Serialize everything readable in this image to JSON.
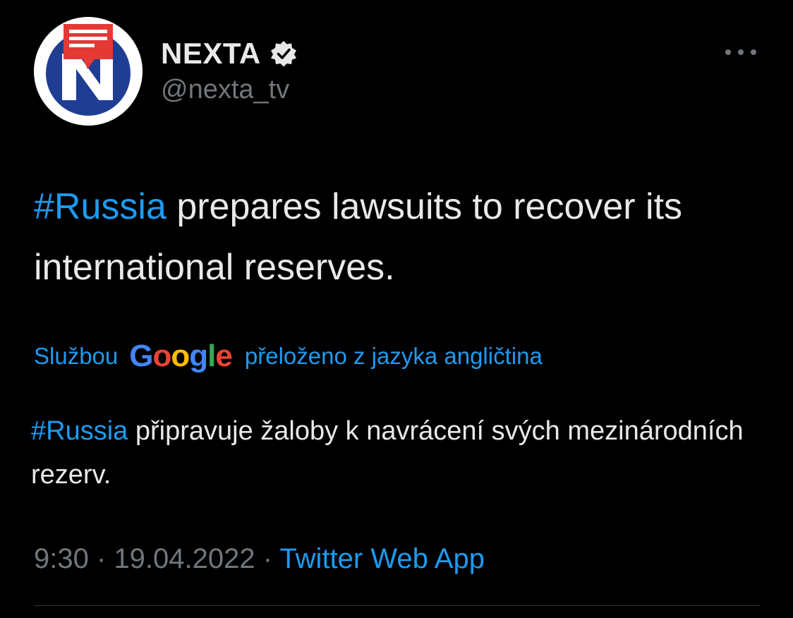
{
  "colors": {
    "background": "#000000",
    "text": "#e7e9ea",
    "muted": "#71767b",
    "accent": "#1d9bf0",
    "divider": "#2f3336"
  },
  "author": {
    "display_name": "NEXTA",
    "handle": "@nexta_tv",
    "verified": true,
    "avatar_icon": "nexta-logo",
    "verified_icon": "verified-badge-icon"
  },
  "more_icon": "more-options-icon",
  "tweet": {
    "hashtag": "#Russia",
    "text": " prepares lawsuits to recover its international reserves."
  },
  "translation": {
    "prefix": "Službou",
    "provider": "Google",
    "suffix": "přeloženo z jazyka angličtina",
    "hashtag": "#Russia",
    "text": " připravuje žaloby k navrácení svých mezinárodních rezerv."
  },
  "meta": {
    "time": "9:30",
    "separator": " · ",
    "date": "19.04.2022",
    "source": "Twitter Web App"
  }
}
